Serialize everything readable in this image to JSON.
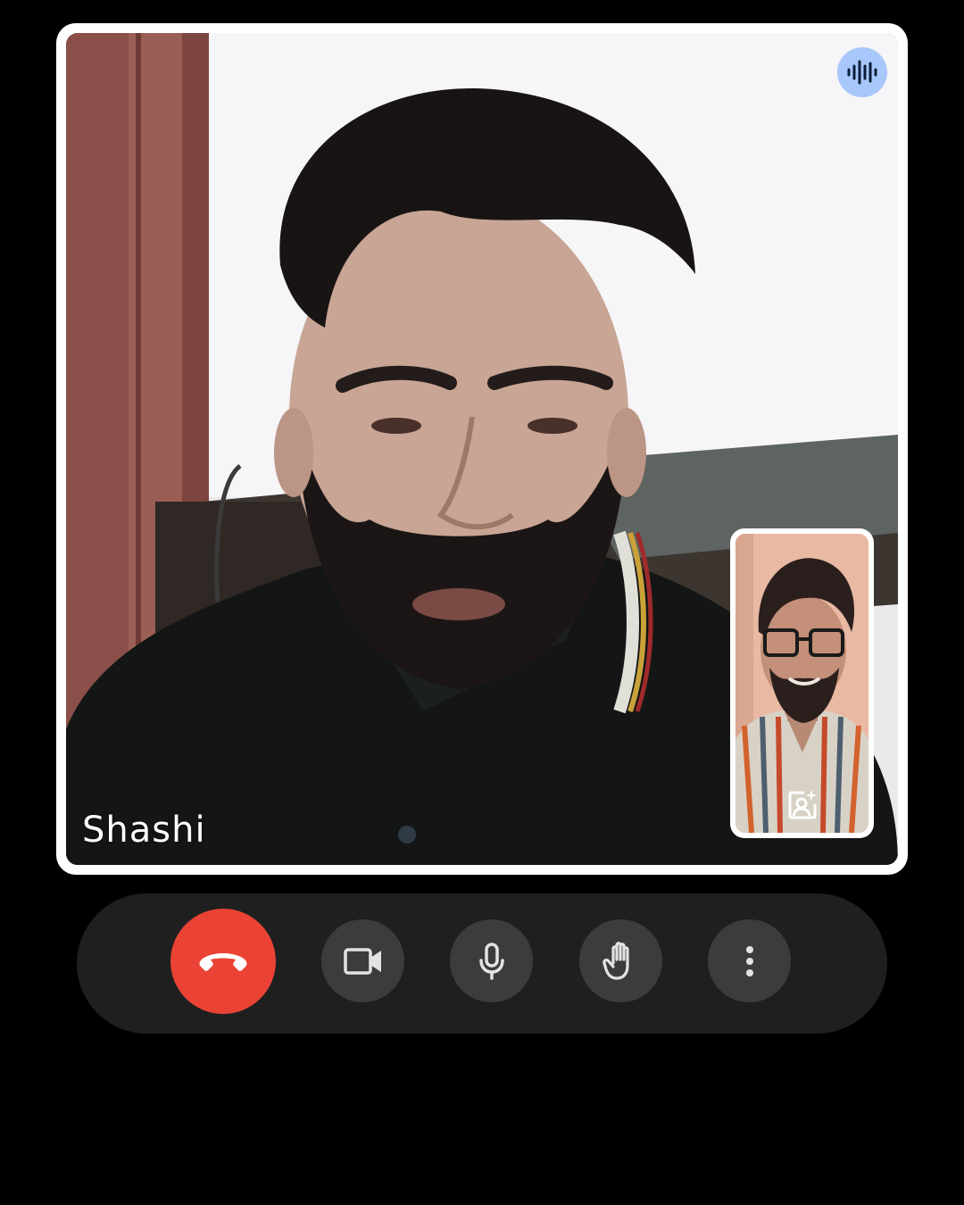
{
  "call": {
    "main_participant": {
      "name": "Shashi",
      "speaking_icon": "audio-wave-icon",
      "speaking_badge_color": "#a8c7fa"
    },
    "self_view": {
      "effects_icon": "portrait-sparkle-icon"
    }
  },
  "controls": {
    "end_call": {
      "icon": "phone-hangup-icon",
      "color": "#ea4335"
    },
    "camera": {
      "icon": "videocam-icon"
    },
    "microphone": {
      "icon": "mic-icon"
    },
    "raise_hand": {
      "icon": "hand-icon"
    },
    "more_options": {
      "icon": "more-vertical-icon"
    },
    "bar_color": "#1f1f1f",
    "button_color": "#3c3c3c"
  }
}
